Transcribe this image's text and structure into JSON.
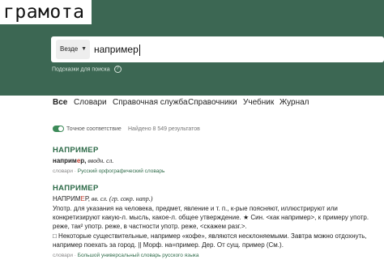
{
  "logo": "грамота",
  "search": {
    "scope": "Везде",
    "query": "например",
    "hints_label": "Подсказки для поиска"
  },
  "tabs": [
    "Все",
    "Словари",
    "Справочная служба",
    "Справочники",
    "Учебник",
    "Журнал"
  ],
  "active_tab": "Все",
  "options": {
    "exact_match": "Точное соответствие",
    "found": "Найдено 8 549 результатов"
  },
  "entries": [
    {
      "title": "НАПРИМЕР",
      "lines": [
        {
          "head": "наприм",
          "accent": "е",
          "tail": "р,",
          "note": " вводн. сл."
        }
      ],
      "source_prefix": "словари",
      "source_link": "Русский орфографический словарь"
    },
    {
      "title": "НАПРИМЕР",
      "head_line": {
        "head": "НАПРИМ",
        "accent": "Е",
        "tail": "Р,",
        "note": " вв. сл. (гр. сокр. напр.)"
      },
      "body": [
        "Употр. для указания на человека, предмет, явление и т. п., к-рые поясняют, иллюстрируют или",
        "конкретизируют какую-л. мысль, какое-л. общее утверждение. ★ Син. <как например>, к примеру употр.",
        "реже, так² употр. реже, в частности употр. реже, <скажем разг.>.",
        "□ Некоторые существительные, например «кофе», являются несклоняемыми. Завтра можно отдохнуть,",
        "например поехать за город. || Морф. на=пример. Дер. От сущ. пример (См.)."
      ],
      "source_prefix": "словари",
      "source_link": "Большой универсальный словарь русского языка"
    }
  ],
  "colors": {
    "header_bg": "#3c6753",
    "accent_green": "#2d6a48",
    "stress_red": "#c0392b"
  }
}
